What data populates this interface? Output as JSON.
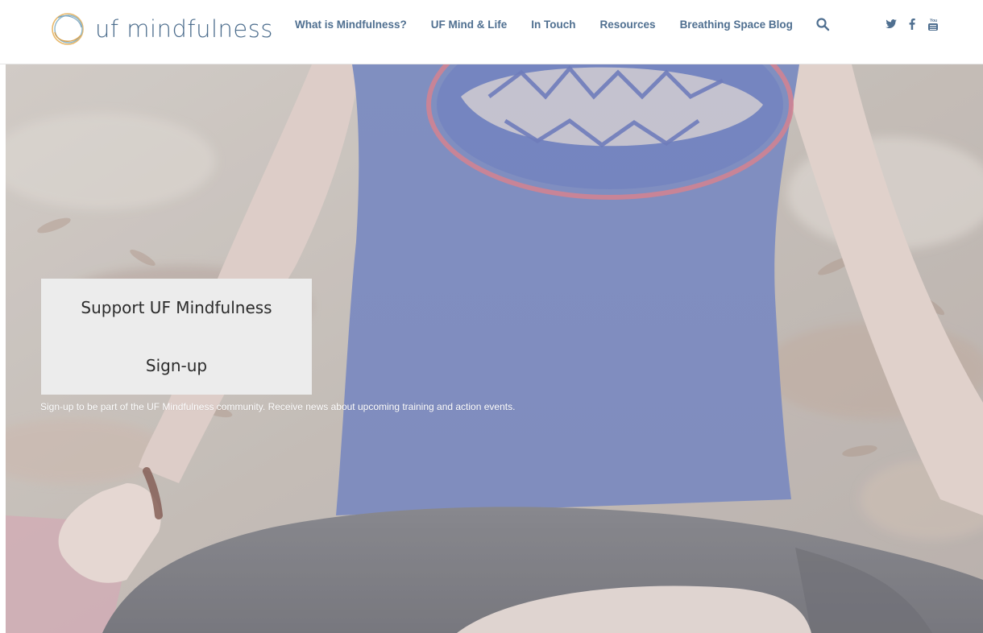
{
  "site": {
    "name": "uf mindfulness",
    "brand_color": "#4f6f90"
  },
  "nav": {
    "items": [
      {
        "label": "What is Mindfulness?"
      },
      {
        "label": "UF Mind & Life"
      },
      {
        "label": "In Touch"
      },
      {
        "label": "Resources"
      },
      {
        "label": "Breathing Space Blog"
      }
    ],
    "search_icon": "search-icon"
  },
  "social": {
    "twitter": {
      "glyph": "❧",
      "icon": "twitter-icon"
    },
    "facebook": {
      "glyph": "f",
      "icon": "facebook-icon"
    },
    "youtube": {
      "glyph": "You",
      "icon": "youtube-icon"
    }
  },
  "hero": {
    "support_label": "Support UF Mindfulness",
    "signup_label": "Sign-up",
    "signup_caption": "Sign-up to be part of the UF Mindfulness community. Receive news about upcoming training and action events."
  }
}
